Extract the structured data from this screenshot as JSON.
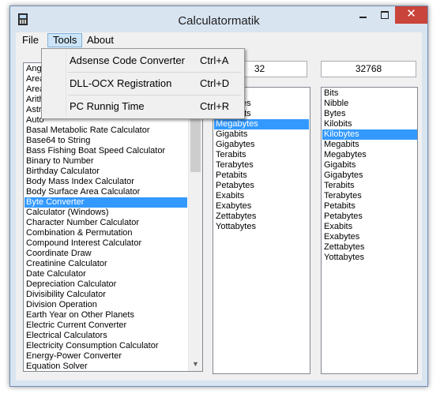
{
  "window": {
    "title": "Calculatormatik",
    "close_glyph": "✕"
  },
  "menu": {
    "file": "File",
    "tools": "Tools",
    "about": "About"
  },
  "tools_menu": {
    "items": [
      {
        "label": "Adsense Code Converter",
        "shortcut": "Ctrl+A"
      },
      {
        "label": "DLL-OCX Registration",
        "shortcut": "Ctrl+D"
      },
      {
        "label": "PC Runnig Time",
        "shortcut": "Ctrl+R"
      }
    ]
  },
  "calculators": {
    "items": [
      "Ange",
      "Area",
      "Area",
      "Arith",
      "Astro",
      "Auto",
      "Basal Metabolic Rate Calculator",
      "Base64 to String",
      "Bass Fishing Boat Speed Calculator",
      "Binary to Number",
      "Birthday Calculator",
      "Body Mass Index Calculator",
      "Body Surface Area Calculator",
      "Byte Converter",
      "Calculator (Windows)",
      "Character Number Calculator",
      "Combination & Permutation",
      "Compound Interest Calculator",
      "Coordinate Draw",
      "Creatinine Calculator",
      "Date Calculator",
      "Depreciation Calculator",
      "Divisibility Calculator",
      "Division Operation",
      "Earth Year on Other Planets",
      "Electric Current Converter",
      "Electrical Calculators",
      "Electricity Consumption Calculator",
      "Energy-Power Converter",
      "Equation Solver"
    ],
    "selected": "Byte Converter",
    "scroll_up": "▲",
    "scroll_down": "▼"
  },
  "converter": {
    "from_value": "32",
    "to_value": "32768",
    "from_units": [
      "Kilobits",
      "Kilobytes",
      "Megabits",
      "Megabytes",
      "Gigabits",
      "Gigabytes",
      "Terabits",
      "Terabytes",
      "Petabits",
      "Petabytes",
      "Exabits",
      "Exabytes",
      "Zettabytes",
      "Yottabytes"
    ],
    "from_selected": "Megabytes",
    "to_units": [
      "Bits",
      "Nibble",
      "Bytes",
      "Kilobits",
      "Kilobytes",
      "Megabits",
      "Megabytes",
      "Gigabits",
      "Gigabytes",
      "Terabits",
      "Terabytes",
      "Petabits",
      "Petabytes",
      "Exabits",
      "Exabytes",
      "Zettabytes",
      "Yottabytes"
    ],
    "to_selected": "Kilobytes"
  },
  "colors": {
    "selection": "#3399ff",
    "menu_highlight": "#cce4f7",
    "close_button": "#c9443a"
  }
}
